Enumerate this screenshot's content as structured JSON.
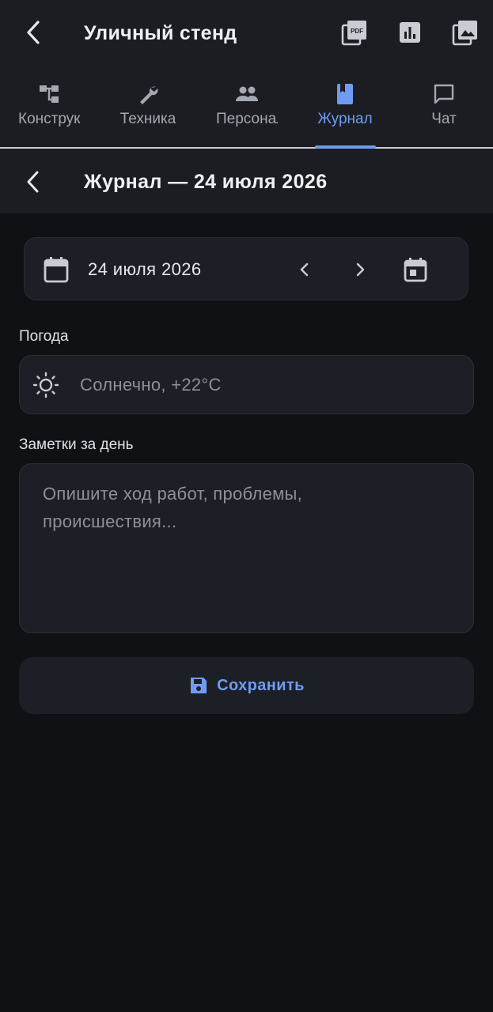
{
  "header": {
    "title": "Уличный стенд",
    "actions": [
      {
        "name": "pdf-icon",
        "label": "PDF"
      },
      {
        "name": "bar-chart-icon"
      },
      {
        "name": "image-icon"
      }
    ]
  },
  "tabs": [
    {
      "label": "Конструкции",
      "icon": "hierarchy-icon",
      "active": false
    },
    {
      "label": "Техника",
      "icon": "wrench-icon",
      "active": false
    },
    {
      "label": "Персонал",
      "icon": "people-icon",
      "active": false
    },
    {
      "label": "Журнал",
      "icon": "bookmark-book-icon",
      "active": true
    },
    {
      "label": "Чат",
      "icon": "chat-bubble-icon",
      "active": false
    }
  ],
  "subheader": {
    "title": "Журнал — 24 июля 2026"
  },
  "date_picker": {
    "value": "24 июля 2026"
  },
  "weather": {
    "label": "Погода",
    "placeholder": "Солнечно, +22°C"
  },
  "notes": {
    "label": "Заметки за день",
    "placeholder": "Опишите ход работ, проблемы, происшествия..."
  },
  "save_button": {
    "label": "Сохранить"
  },
  "colors": {
    "accent": "#6f9cf2",
    "background": "#0f1115",
    "surface": "#1c1f25",
    "header": "#1b1d22"
  }
}
